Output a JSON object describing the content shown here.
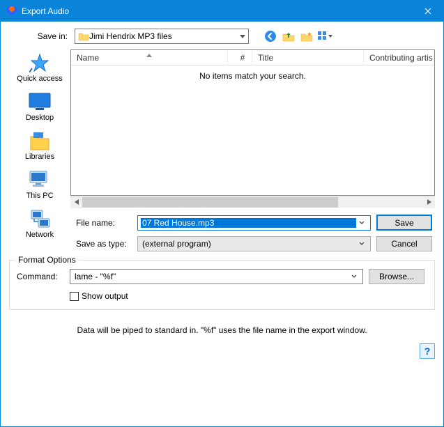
{
  "title": "Export Audio",
  "top": {
    "save_in_label": "Save in:",
    "save_in_value": "Jimi Hendrix MP3 files"
  },
  "places": {
    "quick_access": "Quick access",
    "desktop": "Desktop",
    "libraries": "Libraries",
    "this_pc": "This PC",
    "network": "Network"
  },
  "columns": {
    "name": "Name",
    "num": "#",
    "title": "Title",
    "contrib": "Contributing artis"
  },
  "list": {
    "empty": "No items match your search."
  },
  "file": {
    "name_label": "File name:",
    "name_value": "07 Red House.mp3",
    "type_label": "Save as type:",
    "type_value": "(external program)"
  },
  "buttons": {
    "save": "Save",
    "cancel": "Cancel",
    "browse": "Browse..."
  },
  "format": {
    "legend": "Format Options",
    "command_label": "Command:",
    "command_value": "lame - \"%f\"",
    "show_output": "Show output"
  },
  "note": "Data will be piped to standard in. \"%f\" uses the file name in the export window.",
  "help": "?"
}
